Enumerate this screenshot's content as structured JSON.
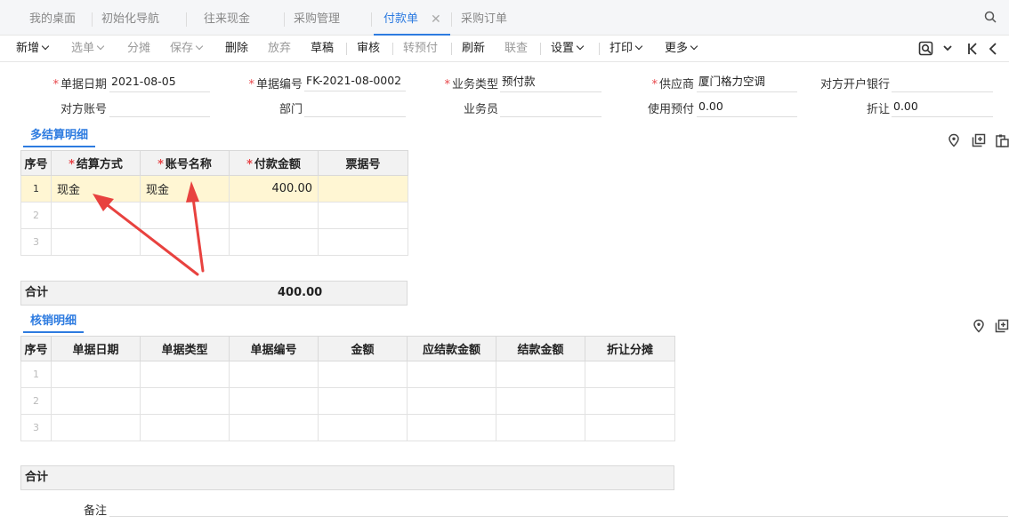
{
  "tabs": [
    {
      "label": "我的桌面",
      "active": false
    },
    {
      "label": "初始化导航",
      "active": false
    },
    {
      "label": "往来现金",
      "active": false
    },
    {
      "label": "采购管理",
      "active": false
    },
    {
      "label": "付款单",
      "active": true
    },
    {
      "label": "采购订单",
      "active": false
    }
  ],
  "toolbar": {
    "new": "新增",
    "select": "选单",
    "allocate": "分摊",
    "save": "保存",
    "delete": "删除",
    "abandon": "放弃",
    "draft": "草稿",
    "audit": "审核",
    "to_prepay": "转预付",
    "refresh": "刷新",
    "linked_query": "联查",
    "settings": "设置",
    "print": "打印",
    "more": "更多"
  },
  "form": {
    "doc_date_label": "单据日期",
    "doc_date": "2021-08-05",
    "doc_no_label": "单据编号",
    "doc_no": "FK-2021-08-0002",
    "biz_type_label": "业务类型",
    "biz_type": "预付款",
    "supplier_label": "供应商",
    "supplier": "厦门格力空调",
    "bank_label": "对方开户银行",
    "bank": "",
    "account_label": "对方账号",
    "account": "",
    "dept_label": "部门",
    "dept": "",
    "staff_label": "业务员",
    "staff": "",
    "use_prepay_label": "使用预付",
    "use_prepay": "0.00",
    "discount_label": "折让",
    "discount": "0.00"
  },
  "settlement": {
    "title": "多结算明细",
    "headers": [
      "序号",
      "结算方式",
      "账号名称",
      "付款金额",
      "票据号"
    ],
    "rows": [
      {
        "no": "1",
        "method": "现金",
        "account_name": "现金",
        "amount": "400.00",
        "ticket": ""
      },
      {
        "no": "2",
        "method": "",
        "account_name": "",
        "amount": "",
        "ticket": ""
      },
      {
        "no": "3",
        "method": "",
        "account_name": "",
        "amount": "",
        "ticket": ""
      }
    ],
    "total_label": "合计",
    "total": "400.00"
  },
  "writeoff": {
    "title": "核销明细",
    "headers": [
      "序号",
      "单据日期",
      "单据类型",
      "单据编号",
      "金额",
      "应结款金额",
      "结款金额",
      "折让分摊"
    ],
    "rows": [
      {
        "no": "1"
      },
      {
        "no": "2"
      },
      {
        "no": "3"
      }
    ],
    "total_label": "合计"
  },
  "remark_label": "备注",
  "colors": {
    "accent": "#2d7be0",
    "required": "#e8464a",
    "selected_row": "#fff6d3",
    "annotation_arrow": "#e8423f"
  }
}
